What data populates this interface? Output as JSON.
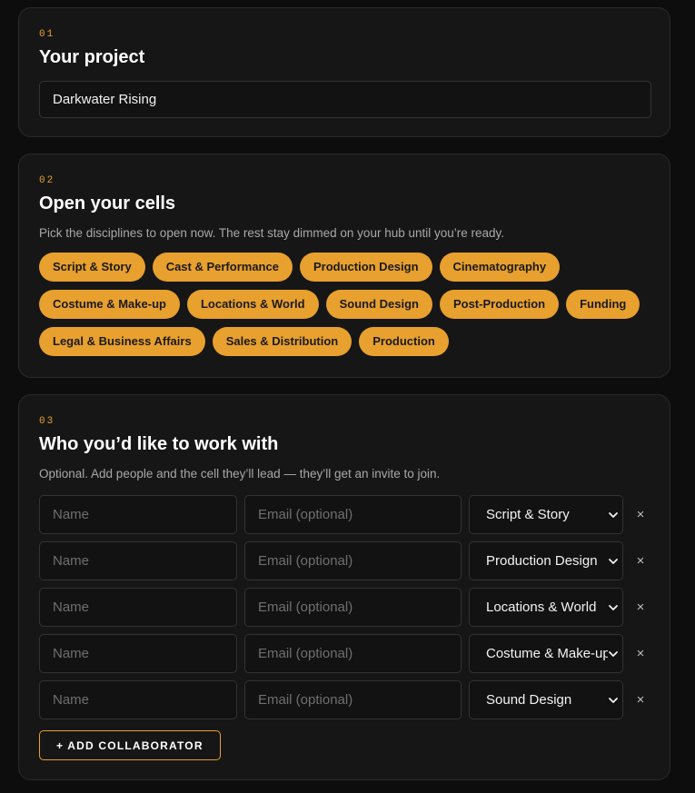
{
  "project": {
    "step": "01",
    "title": "Your project",
    "value": "Darkwater Rising"
  },
  "cells": {
    "step": "02",
    "title": "Open your cells",
    "description": "Pick the disciplines to open now. The rest stay dimmed on your hub until you’re ready.",
    "chips": [
      "Script & Story",
      "Cast & Performance",
      "Production Design",
      "Cinematography",
      "Costume & Make-up",
      "Locations & World",
      "Sound Design",
      "Post-Production",
      "Funding",
      "Legal & Business Affairs",
      "Sales & Distribution",
      "Production"
    ]
  },
  "collaborators": {
    "step": "03",
    "title": "Who you’d like to work with",
    "description": "Optional. Add people and the cell they’ll lead — they’ll get an invite to join.",
    "name_placeholder": "Name",
    "email_placeholder": "Email (optional)",
    "remove_glyph": "×",
    "rows": [
      {
        "cell": "Script & Story"
      },
      {
        "cell": "Production Design"
      },
      {
        "cell": "Locations & World"
      },
      {
        "cell": "Costume & Make-up"
      },
      {
        "cell": "Sound Design"
      }
    ],
    "add_label": "+ ADD COLLABORATOR"
  },
  "colors": {
    "accent": "#e8a02e",
    "background": "#0d0d0d",
    "card": "#161616"
  }
}
